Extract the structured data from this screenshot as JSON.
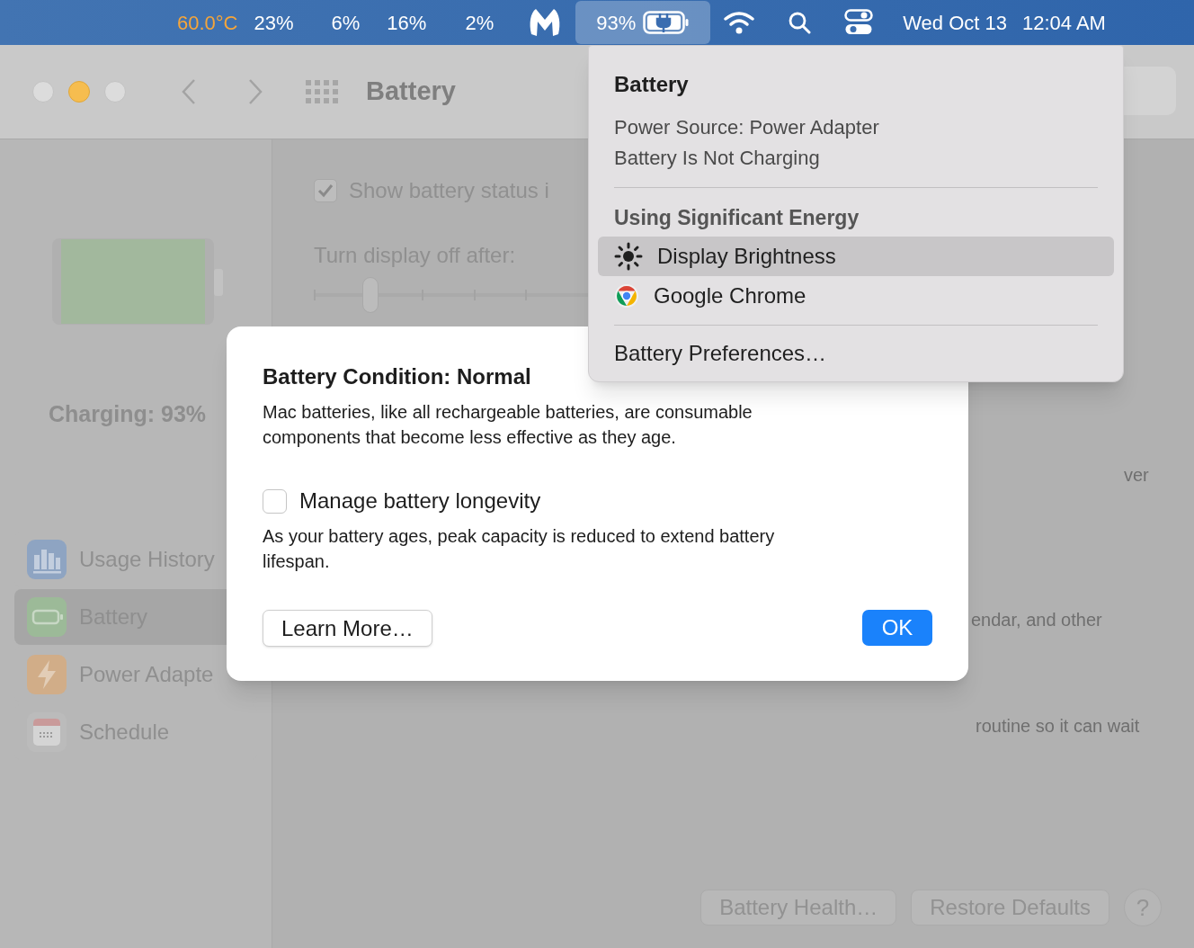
{
  "menu_bar": {
    "items": [
      {
        "kind": "temperature",
        "label": "60.0°C"
      },
      {
        "kind": "text",
        "label": "23%"
      },
      {
        "kind": "text",
        "label": "6%"
      },
      {
        "kind": "text",
        "label": "16%"
      },
      {
        "kind": "text",
        "label": "2%"
      },
      {
        "kind": "shield"
      },
      {
        "kind": "battery",
        "label": "93%",
        "selected": true
      },
      {
        "kind": "wifi"
      },
      {
        "kind": "search"
      },
      {
        "kind": "control"
      },
      {
        "kind": "text",
        "label": "Wed Oct 13"
      },
      {
        "kind": "text",
        "label": "12:04 AM"
      }
    ]
  },
  "window": {
    "title": "Battery",
    "charge_label": "Charging: 93%",
    "sidebar": [
      {
        "kind": "usage",
        "label": "Usage History",
        "selected": false
      },
      {
        "kind": "battery",
        "label": "Battery",
        "selected": true
      },
      {
        "kind": "power",
        "label": "Power Adapte",
        "selected": false
      },
      {
        "kind": "schedule",
        "label": "Schedule",
        "selected": false
      }
    ],
    "status_checkbox": {
      "label": "Show battery status i",
      "checked": true
    },
    "display_off": {
      "label": "Turn display off after:",
      "level": 0.07
    },
    "partial_texts": [
      "ver",
      "endar, and other",
      "routine so it can wait"
    ],
    "buttons": [
      "Battery Health…",
      "Restore Defaults",
      "?"
    ]
  },
  "dialog": {
    "title": "Battery Condition: Normal",
    "message": "Mac batteries, like all rechargeable batteries, are consumable components that become less effective as they age.",
    "checkbox": {
      "label": "Manage battery longevity",
      "checked": false
    },
    "description": "As your battery ages, peak capacity is reduced to extend battery lifespan.",
    "buttons": [
      {
        "label": "Learn More…",
        "kind": "secondary"
      },
      {
        "label": "OK",
        "kind": "primary"
      }
    ]
  },
  "battery_menu": {
    "title": "Battery",
    "status": [
      "Power Source: Power Adapter",
      "Battery Is Not Charging"
    ],
    "section_title": "Using Significant Energy",
    "apps": [
      {
        "kind": "brightness",
        "label": "Display Brightness",
        "selected": true
      },
      {
        "kind": "chrome",
        "label": "Google Chrome",
        "selected": false
      }
    ],
    "footer_item": "Battery Preferences…"
  }
}
